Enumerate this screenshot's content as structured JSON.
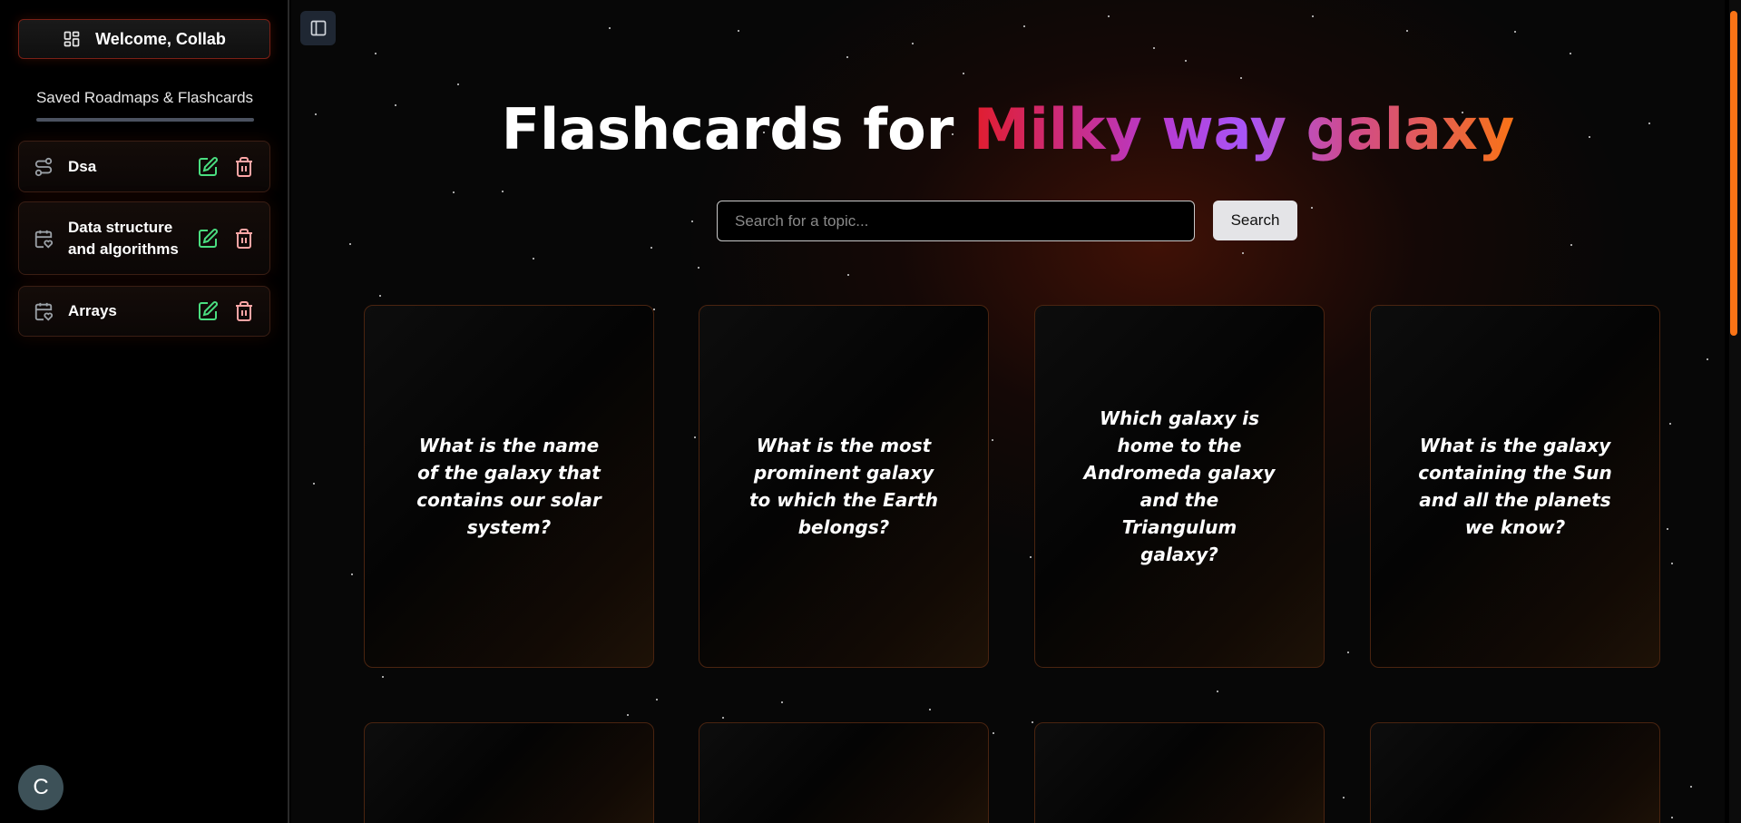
{
  "sidebar": {
    "welcome_label": "Welcome, Collab",
    "saved_title": "Saved Roadmaps & Flashcards",
    "items": [
      {
        "label": "Dsa",
        "icon": "route-icon"
      },
      {
        "label": "Data structure and algorithms",
        "icon": "calendar-heart-icon"
      },
      {
        "label": "Arrays",
        "icon": "calendar-heart-icon"
      }
    ],
    "avatar_initial": "C"
  },
  "main": {
    "title_prefix": "Flashcards for ",
    "title_topic": "Milky way galaxy",
    "search": {
      "placeholder": "Search for a topic...",
      "button_label": "Search"
    },
    "cards": [
      {
        "question": "What is the name of the galaxy that contains our solar system?"
      },
      {
        "question": "What is the most prominent galaxy to which the Earth belongs?"
      },
      {
        "question": "Which galaxy is home to the Andromeda galaxy and the Triangulum galaxy?"
      },
      {
        "question": "What is the galaxy containing the Sun and all the planets we know?"
      }
    ]
  },
  "colors": {
    "accent_orange": "#f97316",
    "accent_red": "#e11d2e",
    "accent_purple": "#a855f7",
    "edit_green": "#4ade80",
    "trash_pink": "#fca5a5"
  }
}
